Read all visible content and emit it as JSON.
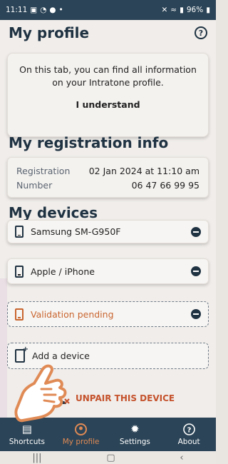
{
  "status_bar": {
    "time": "11:11",
    "battery": "96%"
  },
  "header": {
    "title": "My profile"
  },
  "info_card": {
    "text": "On this tab, you can find all information on your Intratone profile.",
    "button": "I understand"
  },
  "registration": {
    "title": "My registration info",
    "rows": [
      {
        "label": "Registration",
        "value": "02 Jan 2024 at 11:10 am"
      },
      {
        "label": "Number",
        "value": "06 47 66 99 95"
      }
    ]
  },
  "devices": {
    "title": "My devices",
    "items": [
      {
        "label": "Samsung SM-G950F"
      },
      {
        "label": "Apple / iPhone"
      },
      {
        "label": "Validation pending"
      }
    ],
    "add_label": "Add a device",
    "unpair_label": "UNPAIR THIS DEVICE"
  },
  "nav": {
    "items": [
      {
        "label": "Shortcuts"
      },
      {
        "label": "My profile"
      },
      {
        "label": "Settings"
      },
      {
        "label": "About"
      }
    ]
  },
  "colors": {
    "nav_bg": "#2b4457",
    "accent": "#e08a55",
    "unpair": "#c5522c"
  }
}
